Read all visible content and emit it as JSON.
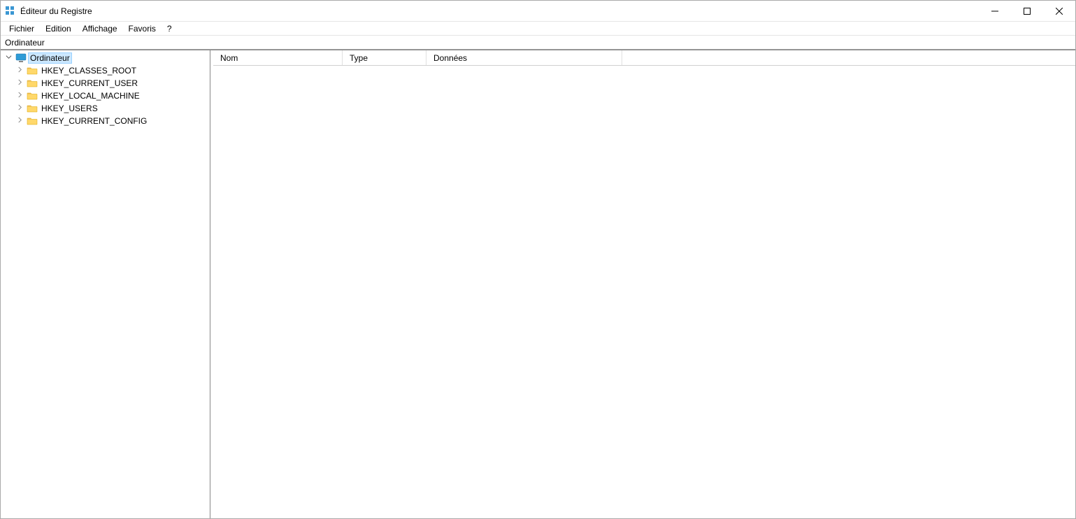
{
  "titlebar": {
    "title": "Éditeur du Registre"
  },
  "menu": {
    "file": "Fichier",
    "edit": "Edition",
    "view": "Affichage",
    "favorites": "Favoris",
    "help": "?"
  },
  "address": "Ordinateur",
  "tree": {
    "root": {
      "label": "Ordinateur",
      "expanded": true,
      "selected": true
    },
    "children": [
      {
        "label": "HKEY_CLASSES_ROOT"
      },
      {
        "label": "HKEY_CURRENT_USER"
      },
      {
        "label": "HKEY_LOCAL_MACHINE"
      },
      {
        "label": "HKEY_USERS"
      },
      {
        "label": "HKEY_CURRENT_CONFIG"
      }
    ]
  },
  "columns": {
    "name": "Nom",
    "type": "Type",
    "data": "Données"
  }
}
